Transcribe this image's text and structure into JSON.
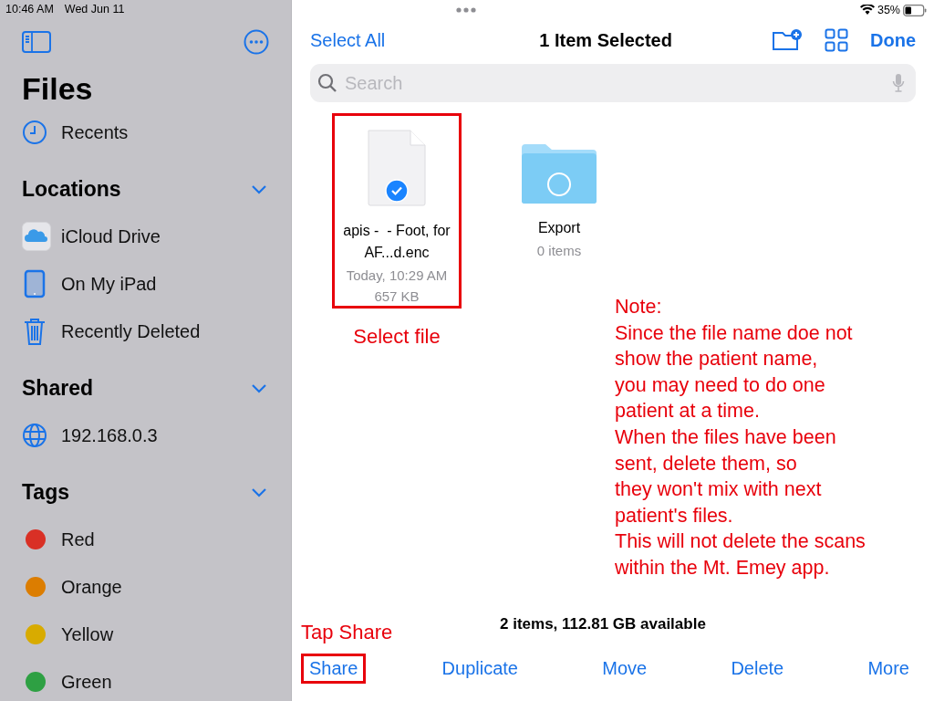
{
  "status_bar": {
    "time": "10:46 AM",
    "date": "Wed Jun 11",
    "battery": "35%"
  },
  "sidebar": {
    "title": "Files",
    "recents": {
      "label": "Recents",
      "kind": "clock"
    },
    "sections": [
      {
        "title": "Locations",
        "expanded": true,
        "items": [
          {
            "label": "iCloud Drive",
            "kind": "cloud"
          },
          {
            "label": "On My iPad",
            "kind": "ipad"
          },
          {
            "label": "Recently Deleted",
            "kind": "trash"
          }
        ]
      },
      {
        "title": "Shared",
        "expanded": true,
        "items": [
          {
            "label": "192.168.0.3",
            "kind": "globe"
          }
        ]
      },
      {
        "title": "Tags",
        "expanded": true,
        "items": [
          {
            "label": "Red",
            "kind": "tag",
            "color": "#d93025"
          },
          {
            "label": "Orange",
            "kind": "tag",
            "color": "#dc7d00"
          },
          {
            "label": "Yellow",
            "kind": "tag",
            "color": "#d8ab00"
          },
          {
            "label": "Green",
            "kind": "tag",
            "color": "#2ea043"
          }
        ]
      }
    ]
  },
  "toolbar": {
    "select_all": "Select All",
    "title": "1 Item Selected",
    "done": "Done"
  },
  "search": {
    "placeholder": "Search"
  },
  "items": [
    {
      "kind": "file",
      "name": "apis -  - Foot, for AF...d.enc",
      "date": "Today, 10:29 AM",
      "size": "657 KB",
      "selected": true,
      "highlighted": true
    },
    {
      "kind": "folder",
      "name": "Export",
      "count": "0 items",
      "selected": false,
      "highlighted": false
    }
  ],
  "annotations": {
    "select_label": "Select file",
    "note_lines": [
      "Note:",
      "Since the file name doe not",
      "show the patient name,",
      "you may need to do one",
      "patient at a time.",
      "When the files have been",
      "sent, delete them, so",
      "they won't mix with next",
      "patient's files.",
      "This will not delete the scans",
      "within the Mt. Emey app."
    ],
    "share_label": "Tap Share"
  },
  "footer": "2 items, 112.81 GB available",
  "actions": [
    {
      "label": "Share",
      "highlighted": true
    },
    {
      "label": "Duplicate",
      "highlighted": false
    },
    {
      "label": "Move",
      "highlighted": false
    },
    {
      "label": "Delete",
      "highlighted": false
    },
    {
      "label": "More",
      "highlighted": false
    }
  ]
}
